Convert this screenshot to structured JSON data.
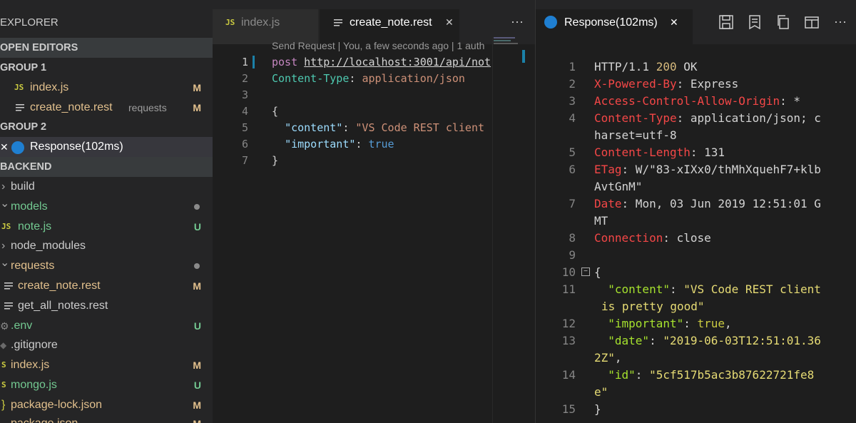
{
  "sidebar": {
    "title": "EXPLORER",
    "open_editors": "OPEN EDITORS",
    "group1": "GROUP 1",
    "group1_items": [
      {
        "icon": "JS",
        "name": "index.js",
        "badge": "M"
      },
      {
        "icon": "lines",
        "name": "create_note.rest",
        "desc": "requests",
        "badge": "M"
      }
    ],
    "group2": "GROUP 2",
    "group2_items": [
      {
        "close": "✕",
        "name": "Response(102ms)"
      }
    ],
    "backend": "BACKEND",
    "tree": [
      {
        "chev": "›",
        "name": "build"
      },
      {
        "chev": "⌄",
        "name": "models",
        "dot": true
      },
      {
        "icon": "JS",
        "name": "note.js",
        "badge": "U"
      },
      {
        "chev": "›",
        "name": "node_modules"
      },
      {
        "chev": "⌄",
        "name": "requests",
        "dot": true
      },
      {
        "icon": "lines",
        "name": "create_note.rest",
        "badge": "M"
      },
      {
        "icon": "lines",
        "name": "get_all_notes.rest"
      },
      {
        "icon": "gear",
        "name": ".env",
        "badge": "U"
      },
      {
        "icon": "diamond",
        "name": ".gitignore"
      },
      {
        "icon": "S",
        "name": "index.js",
        "badge": "M"
      },
      {
        "icon": "S",
        "name": "mongo.js",
        "badge": "U"
      },
      {
        "icon": "}",
        "name": "package-lock.json",
        "badge": "M"
      },
      {
        "icon": "",
        "name": "package.json",
        "badge": "M"
      }
    ]
  },
  "editor1": {
    "tabs": [
      {
        "icon": "JS",
        "label": "index.js"
      },
      {
        "icon": "lines",
        "label": "create_note.rest",
        "close": "✕"
      }
    ],
    "more": "···",
    "codelens": "Send Request | You, a few seconds ago | 1 auth",
    "lines": [
      "1",
      "2",
      "3",
      "4",
      "5",
      "6",
      "7"
    ],
    "code": {
      "method": "post",
      "url": "http://localhost:3001/api/not",
      "header_name": "Content-Type",
      "header_value": "application/json",
      "open_brace": "{",
      "content_key": "\"content\"",
      "content_value": "\"VS Code REST client",
      "important_key": "\"important\"",
      "important_value": "true",
      "close_brace": "}"
    }
  },
  "editor2": {
    "tab_label": "Response(102ms)",
    "close": "✕",
    "lines": [
      "1",
      "2",
      "3",
      "4",
      "5",
      "6",
      "7",
      "8",
      "9",
      "10",
      "11",
      "12",
      "13",
      "14",
      "15"
    ],
    "resp": {
      "status_proto": "HTTP/1.1 ",
      "status_code": "200",
      "status_text": " OK",
      "h1_name": "X-Powered-By",
      "h1_val": " Express",
      "h2_name": "Access-Control-Allow-Origin",
      "h2_val": " *",
      "h3_name": "Content-Type",
      "h3_val_a": " application/json; c",
      "h3_val_b": "harset=utf-8",
      "h4_name": "Content-Length",
      "h4_val": " 131",
      "h5_name": "ETag",
      "h5_val_a": " W/\"83-xIXx0/thMhXquehF7+klb",
      "h5_val_b": "AvtGnM\"",
      "h6_name": "Date",
      "h6_val_a": " Mon, 03 Jun 2019 12:51:01 G",
      "h6_val_b": "MT",
      "h7_name": "Connection",
      "h7_val": " close",
      "open_brace": "{",
      "content_key": "\"content\"",
      "content_val_a": "\"VS Code REST client",
      "content_val_b": "is pretty good\"",
      "important_key": "\"important\"",
      "important_val": "true",
      "date_key": "\"date\"",
      "date_val_a": "\"2019-06-03T12:51:01.36",
      "date_val_b": "2Z\"",
      "id_key": "\"id\"",
      "id_val_a": "\"5cf517b5ac3b87622721fe8",
      "id_val_b": "e\"",
      "close_brace": "}"
    }
  }
}
